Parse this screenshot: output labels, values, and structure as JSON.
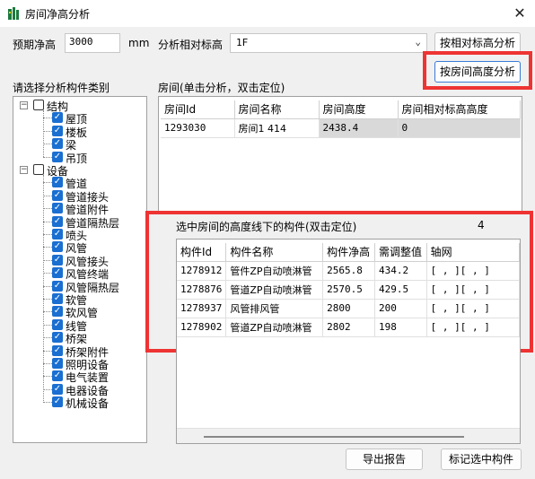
{
  "window": {
    "title": "房间净高分析",
    "close_symbol": "✕"
  },
  "expected_height": {
    "label": "预期净高",
    "value": "3000",
    "unit": "mm"
  },
  "relative_elevation": {
    "label": "分析相对标高",
    "selected": "1F"
  },
  "buttons": {
    "analyze_by_elevation": "按相对标高分析",
    "analyze_by_room_height": "按房间高度分析",
    "export_report": "导出报告",
    "mark_selected": "标记选中构件"
  },
  "category_tree": {
    "heading": "请选择分析构件类别",
    "groups": [
      {
        "label": "结构",
        "checked": false,
        "items": [
          "屋顶",
          "楼板",
          "梁",
          "吊顶"
        ]
      },
      {
        "label": "设备",
        "checked": false,
        "items": [
          "管道",
          "管道接头",
          "管道附件",
          "管道隔热层",
          "喷头",
          "风管",
          "风管接头",
          "风管终端",
          "风管隔热层",
          "软管",
          "软风管",
          "线管",
          "桥架",
          "桥架附件",
          "照明设备",
          "电气装置",
          "电器设备",
          "机械设备"
        ]
      }
    ]
  },
  "rooms": {
    "heading": "房间(单击分析，双击定位)",
    "columns": [
      "房间Id",
      "房间名称",
      "房间高度",
      "房间相对标高高度"
    ],
    "rows": [
      [
        "1293030",
        "房间1 414",
        "2438.4",
        "0"
      ]
    ]
  },
  "components": {
    "heading": "选中房间的高度线下的构件(双击定位)",
    "count": "4",
    "columns": [
      "构件Id",
      "构件名称",
      "构件净高",
      "需调整值",
      "轴网"
    ],
    "rows": [
      [
        "1278912",
        "管件ZP自动喷淋管",
        "2565.8",
        "434.2",
        "[  ,  ][  ,  ]"
      ],
      [
        "1278876",
        "管道ZP自动喷淋管",
        "2570.5",
        "429.5",
        "[  ,  ][  ,  ]"
      ],
      [
        "1278937",
        "风管排风管",
        "2800",
        "200",
        "[  ,  ][  ,  ]"
      ],
      [
        "1278902",
        "管道ZP自动喷淋管",
        "2802",
        "198",
        "[  ,  ][  ,  ]"
      ]
    ]
  },
  "colors": {
    "highlight": "#ee3333",
    "checkbox": "#1a6fd1",
    "selected_row": "#d9d9d9"
  }
}
